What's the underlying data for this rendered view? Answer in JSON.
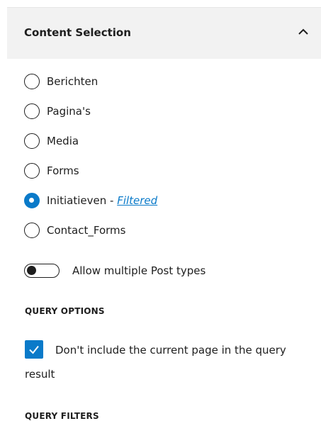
{
  "panel": {
    "title": "Content Selection",
    "expanded": true
  },
  "post_types": [
    {
      "label": "Berichten",
      "checked": false
    },
    {
      "label": "Pagina's",
      "checked": false
    },
    {
      "label": "Media",
      "checked": false
    },
    {
      "label": "Forms",
      "checked": false
    },
    {
      "label": "Initiatieven - ",
      "suffix": "Filtered",
      "checked": true
    },
    {
      "label": "Contact_Forms",
      "checked": false
    }
  ],
  "allow_multiple": {
    "label": "Allow multiple Post types",
    "enabled": false
  },
  "query_options": {
    "heading": "QUERY OPTIONS",
    "exclude_current_label": "Don't include the current page in the query result",
    "exclude_current_checked": true
  },
  "query_filters": {
    "heading": "QUERY FILTERS"
  },
  "colors": {
    "accent": "#0a7ac9",
    "header_bg": "#f2f2f2",
    "text": "#1e1e1e"
  }
}
